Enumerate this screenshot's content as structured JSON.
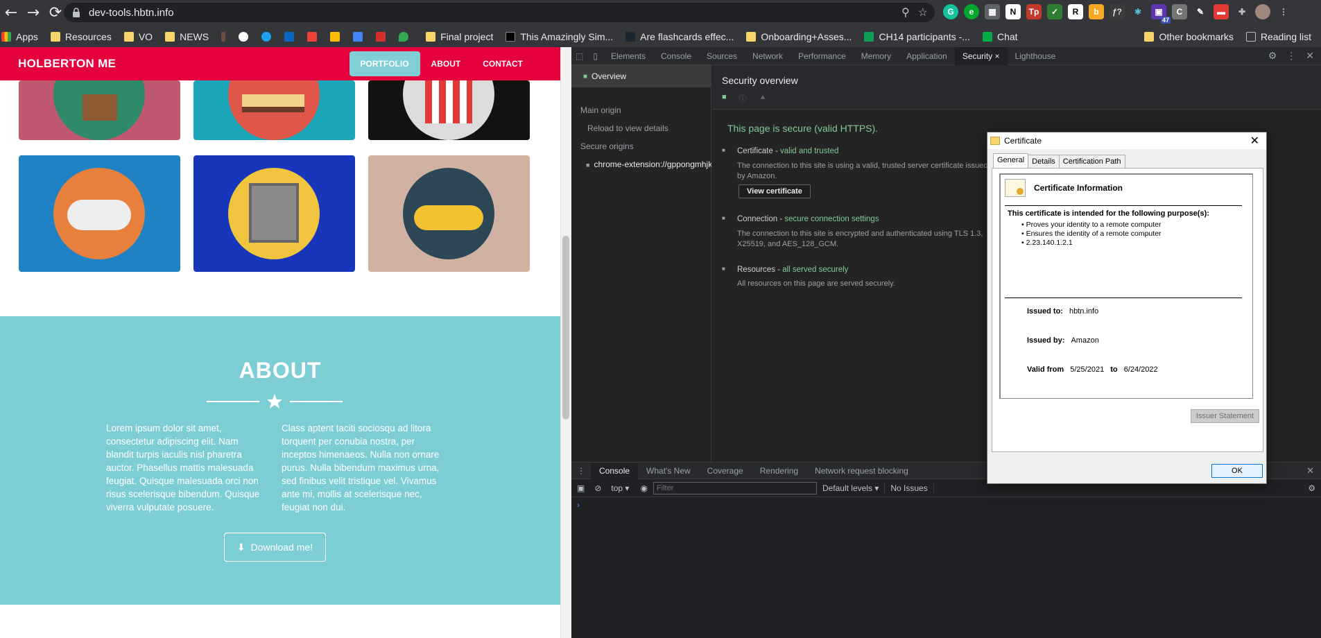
{
  "browser": {
    "url": "dev-tools.hbtn.info",
    "bookmarks": [
      "Apps",
      "Resources",
      "VO",
      "NEWS",
      "Final project",
      "This Amazingly Sim...",
      "Are flashcards effec...",
      "Onboarding+Asses...",
      "CH14 participants -...",
      "Chat"
    ],
    "other_bookmarks": "Other bookmarks",
    "reading_list": "Reading list",
    "ext_badge": "47"
  },
  "site": {
    "logo": "HOLBERTON ME",
    "nav": [
      "PORTFOLIO",
      "ABOUT",
      "CONTACT"
    ],
    "about_title": "ABOUT",
    "about_col1": "Lorem ipsum dolor sit amet, consectetur adipiscing elit. Nam blandit turpis iaculis nisl pharetra auctor. Phasellus mattis malesuada feugiat. Quisque malesuada orci non risus scelerisque bibendum. Quisque viverra vulputate posuere.",
    "about_col2": "Class aptent taciti sociosqu ad litora torquent per conubia nostra, per inceptos himenaeos. Nulla non ornare purus. Nulla bibendum maximus urna, sed finibus velit tristique vel. Vivamus ante mi, mollis at scelerisque nec, feugiat non dui.",
    "download": "Download me!"
  },
  "devtools": {
    "tabs": [
      "Elements",
      "Console",
      "Sources",
      "Network",
      "Performance",
      "Memory",
      "Application",
      "Security",
      "Lighthouse"
    ],
    "side": {
      "overview": "Overview",
      "main_origin": "Main origin",
      "reload": "Reload to view details",
      "secure_origins": "Secure origins",
      "origin_item": "chrome-extension://gppongmhjkpf"
    },
    "main": {
      "title": "Security overview",
      "secure_msg": "This page is secure (valid HTTPS).",
      "cert_label": "Certificate - ",
      "cert_status": "valid and trusted",
      "cert_desc": "The connection to this site is using a valid, trusted server certificate issued by Amazon.",
      "view_cert": "View certificate",
      "conn_label": "Connection - ",
      "conn_status": "secure connection settings",
      "conn_desc": "The connection to this site is encrypted and authenticated using TLS 1.3, X25519, and AES_128_GCM.",
      "res_label": "Resources - ",
      "res_status": "all served securely",
      "res_desc": "All resources on this page are served securely."
    },
    "drawer": {
      "tabs": [
        "Console",
        "What's New",
        "Coverage",
        "Rendering",
        "Network request blocking"
      ],
      "context": "top",
      "filter_placeholder": "Filter",
      "levels": "Default levels",
      "issues": "No Issues"
    }
  },
  "certificate": {
    "title": "Certificate",
    "tabs": [
      "General",
      "Details",
      "Certification Path"
    ],
    "heading": "Certificate Information",
    "purpose_intro": "This certificate is intended for the following purpose(s):",
    "purposes": [
      "Proves your identity to a remote computer",
      "Ensures the identity of a remote computer",
      "2.23.140.1.2.1"
    ],
    "issued_to_label": "Issued to:",
    "issued_to": "hbtn.info",
    "issued_by_label": "Issued by:",
    "issued_by": "Amazon",
    "valid_from_label": "Valid from",
    "valid_from": "5/25/2021",
    "to_label": "to",
    "valid_to": "6/24/2022",
    "issuer_statement": "Issuer Statement",
    "ok": "OK"
  },
  "colors": {
    "brand_red": "#e5003e",
    "teal": "#7dced4",
    "secure_green": "#81c995"
  }
}
